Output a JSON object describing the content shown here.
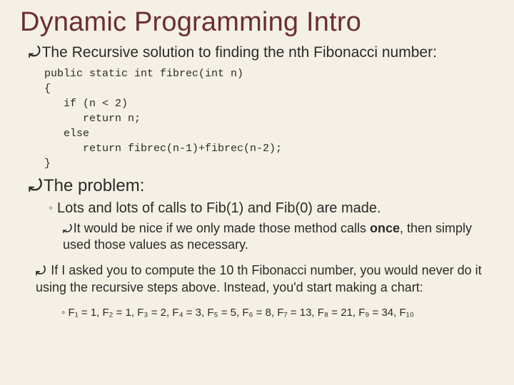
{
  "title": "Dynamic Programming Intro",
  "bullet1": "The Recursive solution to finding the nth Fibonacci number:",
  "code": "public static int fibrec(int n)\n{\n   if (n < 2)\n      return n;\n   else\n      return fibrec(n-1)+fibrec(n-2);\n}",
  "bullet2": "The problem:",
  "sub1_a": "Lots and lots of calls to Fib(1) and Fib(0) are made.",
  "sub2_a": "It would be nice if we only made those method calls ",
  "sub2_b": "once",
  "sub2_c": ", then simply used those values as necessary.",
  "bullet3": "If I asked you to compute the 10 th Fibonacci number, you would never do it using the recursive steps above. Instead, you'd start making a chart:",
  "seq_prefix": "◦  ",
  "seq": "F₁ = 1,  F₂ = 1,  F₃ = 2,  F₄ = 3,  F₅ = 5,  F₆ = 8,  F₇ = 13,  F₈ = 21,  F₉ = 34,  F₁₀",
  "chart_data": {
    "type": "table",
    "title": "Fibonacci sequence values",
    "categories": [
      "F1",
      "F2",
      "F3",
      "F4",
      "F5",
      "F6",
      "F7",
      "F8",
      "F9"
    ],
    "values": [
      1,
      1,
      2,
      3,
      5,
      8,
      13,
      21,
      34
    ]
  }
}
